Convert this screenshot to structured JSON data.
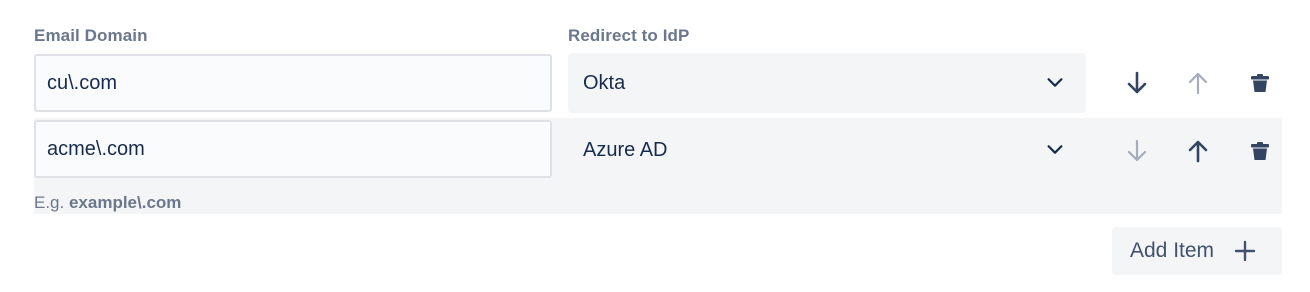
{
  "columns": {
    "email_domain": "Email Domain",
    "redirect_to_idp": "Redirect to IdP"
  },
  "rows": [
    {
      "email_domain": "cu\\.com",
      "idp": "Okta",
      "move_down_enabled": true,
      "move_up_enabled": false
    },
    {
      "email_domain": "acme\\.com",
      "idp": "Azure AD",
      "move_down_enabled": false,
      "move_up_enabled": true
    }
  ],
  "hint": {
    "prefix": "E.g. ",
    "example": "example\\.com"
  },
  "add_button": {
    "label": "Add Item"
  },
  "icons": {
    "move_down": "arrow-down-icon",
    "move_up": "arrow-up-icon",
    "delete": "trash-icon",
    "select": "chevron-down-icon",
    "add": "plus-icon"
  },
  "colors": {
    "text": "#172b4d",
    "muted_label": "#6b778c",
    "enabled_icon": "#42526e",
    "disabled_icon": "#a5adba",
    "field_bg": "#f4f5f7",
    "input_border": "#dfe1e6"
  }
}
